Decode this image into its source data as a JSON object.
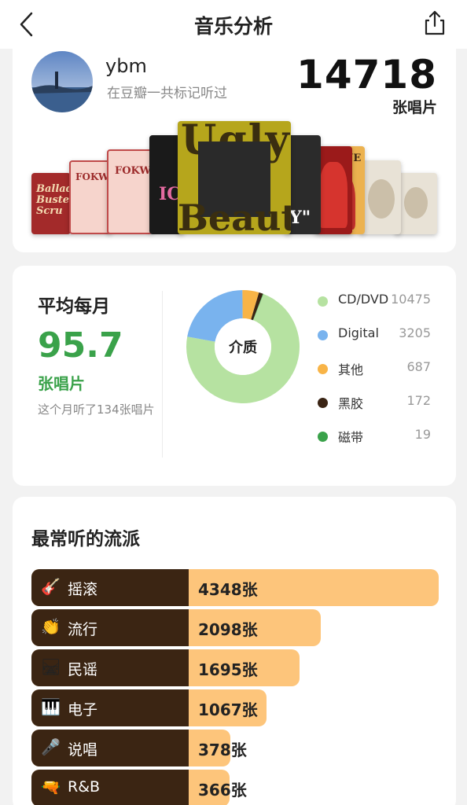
{
  "header": {
    "title": "音乐分析"
  },
  "profile": {
    "username": "ybm",
    "subtitle": "在豆瓣一共标记听过",
    "total": "14718",
    "total_unit": "张唱片"
  },
  "album_covers": [
    {
      "text": "The Ballad of Buster Scruggs",
      "color": "#a32a2a"
    },
    {
      "text": "FOKWA",
      "color": "#f6d4cc"
    },
    {
      "text": "FOKWA",
      "color": "#f6d4cc"
    },
    {
      "text": "IC",
      "color": "#1a1a1a"
    },
    {
      "text": "Ugly Beauty",
      "color": "#b6a61c"
    },
    {
      "text": "Y\"",
      "color": "#2b2b2b"
    },
    {
      "text": "",
      "color": "#9b1a1a"
    },
    {
      "text": "JUNE",
      "color": "#ecb24f"
    },
    {
      "text": "",
      "color": "#e8e2d6"
    },
    {
      "text": "",
      "color": "#e8e2d6"
    }
  ],
  "monthly": {
    "label": "平均每月",
    "value": "95.7",
    "unit": "张唱片",
    "note": "这个月听了134张唱片"
  },
  "media": {
    "center_label": "介质",
    "items": [
      {
        "label": "CD/DVD",
        "value": "10475",
        "count": 10475,
        "color": "#b6e2a1"
      },
      {
        "label": "Digital",
        "value": "3205",
        "count": 3205,
        "color": "#79b3ee"
      },
      {
        "label": "其他",
        "value": "687",
        "count": 687,
        "color": "#f8b447"
      },
      {
        "label": "黑胶",
        "value": "172",
        "count": 172,
        "color": "#3a2414"
      },
      {
        "label": "磁带",
        "value": "19",
        "count": 19,
        "color": "#3aa24a"
      }
    ]
  },
  "genres": {
    "title": "最常听的流派",
    "items": [
      {
        "emoji": "🎸",
        "name": "摇滚",
        "count_label": "4348张",
        "count": 4348
      },
      {
        "emoji": "👏",
        "name": "流行",
        "count_label": "2098张",
        "count": 2098
      },
      {
        "emoji": "🛤",
        "name": "民谣",
        "count_label": "1695张",
        "count": 1695
      },
      {
        "emoji": "🎹",
        "name": "电子",
        "count_label": "1067张",
        "count": 1067
      },
      {
        "emoji": "🎤",
        "name": "说唱",
        "count_label": "378张",
        "count": 378
      },
      {
        "emoji": "🔫",
        "name": "R&B",
        "count_label": "366张",
        "count": 366
      }
    ]
  }
}
